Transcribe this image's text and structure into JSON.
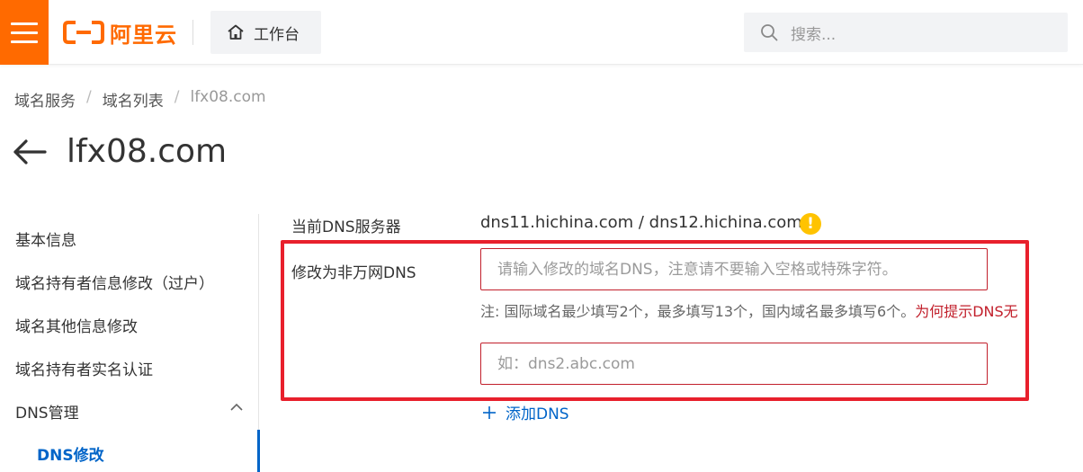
{
  "header": {
    "logo_text": "阿里云",
    "workbench_label": "工作台",
    "search_placeholder": "搜索..."
  },
  "breadcrumb": {
    "items": [
      "域名服务",
      "域名列表",
      "lfx08.com"
    ],
    "separator": "/"
  },
  "page": {
    "title": "lfx08.com"
  },
  "sidebar": {
    "items": [
      "基本信息",
      "域名持有者信息修改（过户）",
      "域名其他信息修改",
      "域名持有者实名认证",
      "DNS管理"
    ],
    "sub_items": [
      "DNS修改"
    ]
  },
  "form": {
    "current_dns_label": "当前DNS服务器",
    "current_dns_value": "dns11.hichina.com / dns12.hichina.com",
    "modify_label": "修改为非万网DNS",
    "input1_placeholder": "请输入修改的域名DNS，注意请不要输入空格或特殊字符。",
    "note_text": "注:   国际域名最少填写2个，最多填写13个，国内域名最多填写6个。",
    "note_link": "为何提示DNS无",
    "input2_placeholder": "如：dns2.abc.com",
    "add_dns_label": "添加DNS"
  },
  "colors": {
    "brand_orange": "#ff6a00",
    "link_blue": "#0064c8",
    "highlight_red": "#e8202c",
    "warning_yellow": "#ffc300"
  }
}
